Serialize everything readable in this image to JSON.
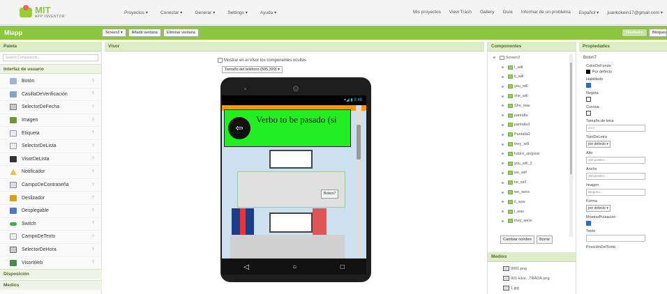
{
  "header": {
    "logo_top": "MIT",
    "logo_bottom": "APP INVENTOR",
    "menu": [
      "Proyectos ▾",
      "Conectar ▾",
      "Generar ▾",
      "Settings ▾",
      "Ayuda ▾"
    ],
    "links": [
      "Mis proyectos",
      "View Trash",
      "Gallery",
      "Guía",
      "Informar de un problema",
      "Español ▾",
      "juankokein17@gmail.com ▾"
    ]
  },
  "projectbar": {
    "name": "Miapp",
    "screen_select": "Screen2 ▾",
    "add_screen": "Añadir ventana",
    "remove_screen": "Eliminar ventana",
    "designer": "Diseñador",
    "blocks": "Bloques"
  },
  "palette": {
    "title": "Paleta",
    "search_placeholder": "Search Components...",
    "category_ui": "Interfaz de usuario",
    "items": [
      "Botón",
      "CasillaDeVerificación",
      "SelectorDeFecha",
      "Imagen",
      "Etiqueta",
      "SelectorDeLista",
      "VisorDeLista",
      "Notificador",
      "CampoDeContraseña",
      "Deslizador",
      "Desplegable",
      "Switch",
      "CampoDeTexto",
      "SelectorDeHora",
      "VisorWeb"
    ],
    "help": "?",
    "category_layout": "Disposición",
    "category_media": "Medios"
  },
  "viewer": {
    "title": "Visor",
    "show_hidden": "Mostrar en el Visor los componentes ocultos",
    "phone_size": "Tamaño del teléfono (505,320) ▾",
    "status_time": "▾◢ ▮ 9:48",
    "banner_text": "Verbo to be pasado (si",
    "back_glyph": "⇦",
    "button_label": "Boton7",
    "nav_back": "◁",
    "nav_home": "○",
    "nav_recent": "□"
  },
  "components": {
    "title": "Componentes",
    "root": "Screen2",
    "items": [
      "I_will",
      "it_will",
      "you_will",
      "she_will",
      "She_was",
      "pantalla",
      "pantalla3",
      "Pantalla2",
      "they_will",
      "futuro_singular",
      "you_will_2",
      "we_will",
      "he_will",
      "we_were",
      "it_was",
      "i_was",
      "they_were"
    ],
    "rename": "Cambiar nombre",
    "delete": "Borrar",
    "media_title": "Medios",
    "media_files": [
      "0001.png",
      "001-Elve...TRADA.png",
      "1.jpg"
    ]
  },
  "properties": {
    "title": "Propiedades",
    "component": "Boton7",
    "bg_label": "ColorDeFondo",
    "bg_value": "Por defecto",
    "enabled_label": "Habilitado",
    "bold_label": "Negrita",
    "italic_label": "Cursiva",
    "fontsize_label": "Tamaño de letra",
    "fontsize_value": "14.0",
    "typeface_label": "TipoDeLetra",
    "typeface_value": "por defecto ▾",
    "height_label": "Alto",
    "height_value": "100 píxeles...",
    "width_label": "Ancho",
    "width_value": "280 píxeles...",
    "image_label": "Imagen",
    "image_value": "Ninguno...",
    "shape_label": "Forma",
    "shape_value": "por defecto ▾",
    "feedback_label": "MostrarPulsación",
    "text_label": "Texto",
    "textpos_label": "PosiciónDelTexto"
  }
}
